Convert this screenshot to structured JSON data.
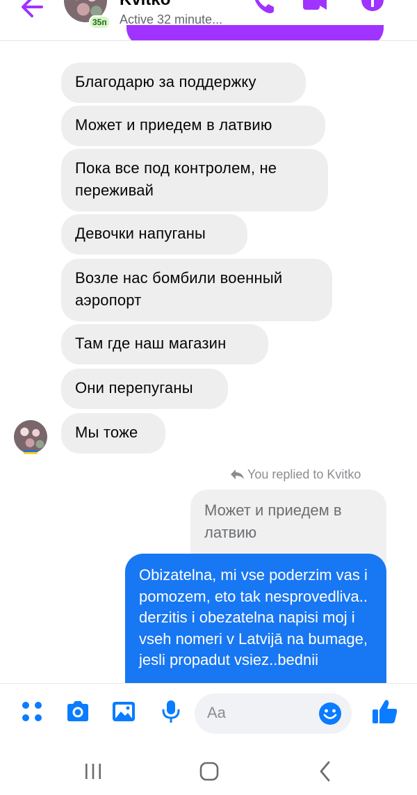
{
  "header": {
    "name": "Kvitko",
    "age_badge": "35п",
    "status": "Active 32 minute..."
  },
  "messages": [
    {
      "text": "Благодарю за поддержку"
    },
    {
      "text": "Может и приедем в латвию"
    },
    {
      "text": "Пока все под контролем, не переживай"
    },
    {
      "text": "Девочки напуганы"
    },
    {
      "text": "Возле нас бомбили военный аэропорт"
    },
    {
      "text": "Там где наш магазин"
    },
    {
      "text": "Они перепуганы"
    },
    {
      "text": "Мы тоже"
    }
  ],
  "reply": {
    "note": "You replied to Kvitko",
    "quoted": "Может и приедем в латвию",
    "sent": "Obizatelna, mi vse poderzim vas i pomozem, eto tak nesprovedliva.. derzitis i obezatelna napisi moj i vseh nomeri v Latvijā na bumage, jesli propadut vsiez..bednii"
  },
  "composer": {
    "placeholder": "Aa"
  },
  "colors": {
    "accent": "#a033ff",
    "sent_bubble": "#1877f2",
    "received_bubble": "#eeeeee",
    "icon_blue": "#0a7cff"
  }
}
